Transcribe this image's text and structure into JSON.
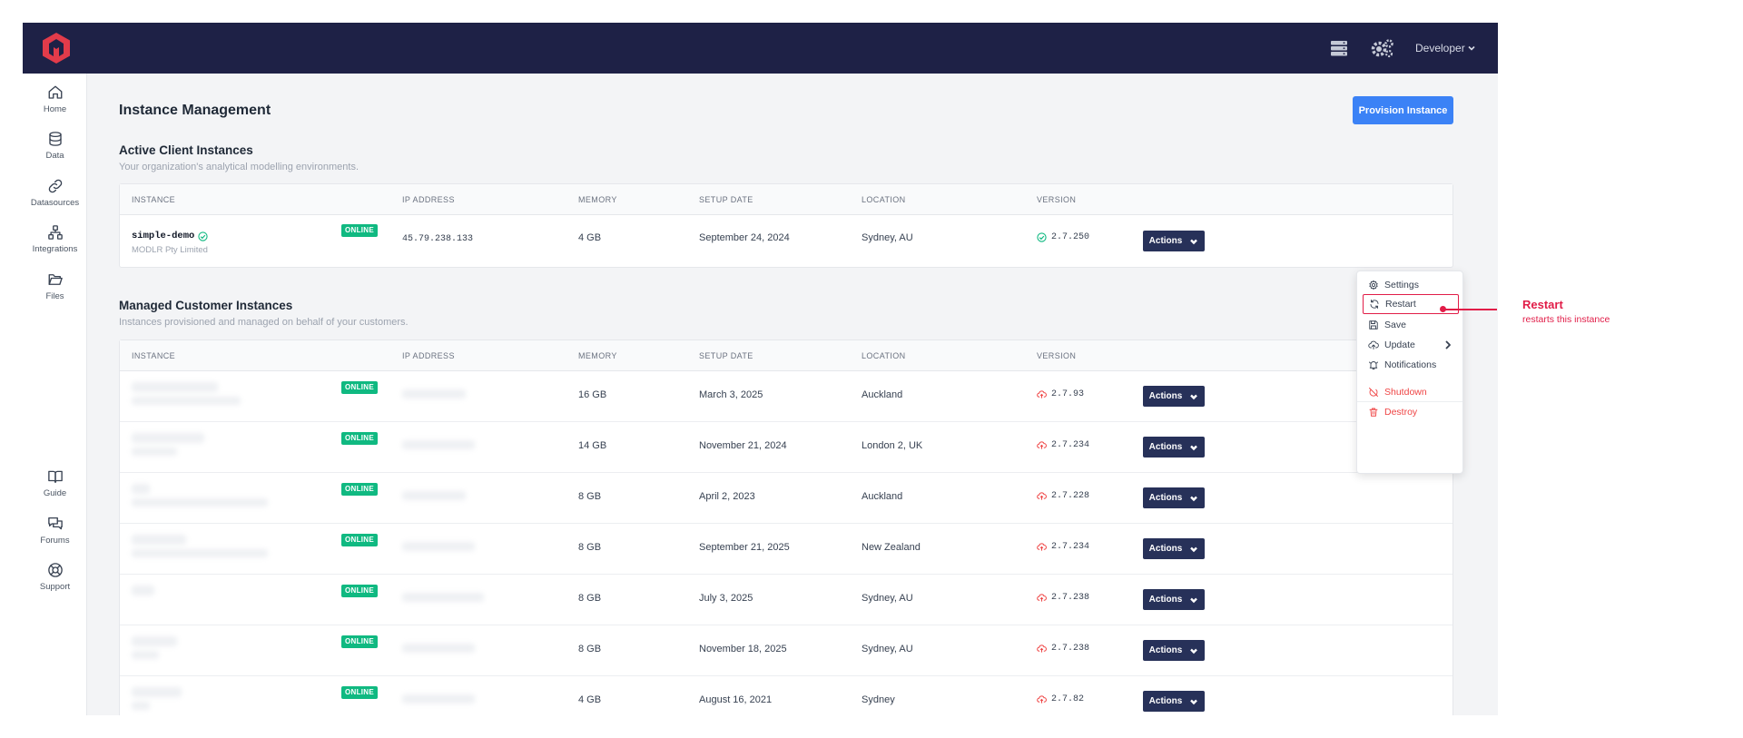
{
  "topbar": {
    "user_label": "Developer",
    "icons": [
      "logo-icon",
      "database-icon",
      "gears-icon",
      "chevron-down-icon"
    ]
  },
  "sidebar": {
    "items": [
      {
        "label": "Home",
        "icon": "home-icon"
      },
      {
        "label": "Data",
        "icon": "database-icon"
      },
      {
        "label": "Datasources",
        "icon": "link-icon"
      },
      {
        "label": "Integrations",
        "icon": "network-icon"
      },
      {
        "label": "Files",
        "icon": "folder-icon"
      }
    ],
    "bottom_items": [
      {
        "label": "Guide",
        "icon": "book-icon"
      },
      {
        "label": "Forums",
        "icon": "chat-icon"
      },
      {
        "label": "Support",
        "icon": "lifebuoy-icon"
      }
    ]
  },
  "page": {
    "title": "Instance Management",
    "provision_label": "Provision Instance"
  },
  "active": {
    "title": "Active Client Instances",
    "subtitle": "Your organization's analytical modelling environments.",
    "columns": [
      "INSTANCE",
      "IP ADDRESS",
      "MEMORY",
      "SETUP DATE",
      "LOCATION",
      "VERSION"
    ],
    "rows": [
      {
        "name": "simple-demo",
        "org": "MODLR Pty Limited",
        "status": "ONLINE",
        "ip": "45.79.238.133",
        "memory": "4 GB",
        "date": "September 24, 2024",
        "location": "Sydney, AU",
        "version": "2.7.250",
        "version_state": "current"
      }
    ]
  },
  "managed": {
    "title": "Managed Customer Instances",
    "subtitle": "Instances provisioned and managed on behalf of your customers.",
    "columns": [
      "INSTANCE",
      "IP ADDRESS",
      "MEMORY",
      "SETUP DATE",
      "LOCATION",
      "VERSION"
    ],
    "rows": [
      {
        "status": "ONLINE",
        "memory": "16 GB",
        "date": "March 3, 2025",
        "location": "Auckland",
        "version": "2.7.93"
      },
      {
        "status": "ONLINE",
        "memory": "14 GB",
        "date": "November 21, 2024",
        "location": "London 2, UK",
        "version": "2.7.234"
      },
      {
        "status": "ONLINE",
        "memory": "8 GB",
        "date": "April 2, 2023",
        "location": "Auckland",
        "version": "2.7.228"
      },
      {
        "status": "ONLINE",
        "memory": "8 GB",
        "date": "September 21, 2025",
        "location": "New Zealand",
        "version": "2.7.234"
      },
      {
        "status": "ONLINE",
        "memory": "8 GB",
        "date": "July 3, 2025",
        "location": "Sydney, AU",
        "version": "2.7.238"
      },
      {
        "status": "ONLINE",
        "memory": "8 GB",
        "date": "November 18, 2025",
        "location": "Sydney, AU",
        "version": "2.7.238"
      },
      {
        "status": "ONLINE",
        "memory": "4 GB",
        "date": "August 16, 2021",
        "location": "Sydney",
        "version": "2.7.82"
      }
    ]
  },
  "actions_label": "Actions",
  "dropdown": {
    "items": [
      {
        "label": "Settings",
        "icon": "gear-icon"
      },
      {
        "label": "Restart",
        "icon": "refresh-icon"
      },
      {
        "label": "Save",
        "icon": "save-icon"
      },
      {
        "label": "Update",
        "icon": "cloud-upload-icon"
      },
      {
        "label": "Notifications",
        "icon": "bell-icon"
      },
      {
        "label": "Shutdown",
        "icon": "power-off-icon"
      },
      {
        "label": "Destroy",
        "icon": "trash-icon"
      }
    ]
  },
  "annotation": {
    "title": "Restart",
    "subtitle": "restarts this instance"
  },
  "colors": {
    "topbar": "#1e2146",
    "accent": "#3b82f6",
    "online": "#10b981",
    "actions": "#273159",
    "danger": "#ef4444",
    "highlight": "#e11d48"
  }
}
